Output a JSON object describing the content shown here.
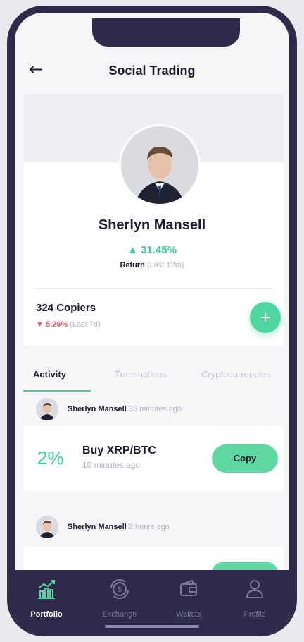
{
  "header": {
    "title": "Social Trading"
  },
  "profile": {
    "name": "Sherlyn Mansell",
    "return_value": "31.45%",
    "return_label": "Return",
    "return_period": "(Last 12m)",
    "copiers": "324 Copiers",
    "copiers_change": "5.26%",
    "copiers_period": "(Last 7d)"
  },
  "tabs": [
    {
      "label": "Activity",
      "active": true
    },
    {
      "label": "Transactions",
      "active": false
    },
    {
      "label": "Cryptocurrencies",
      "active": false
    }
  ],
  "feed": [
    {
      "author": "Sherlyn Mansell",
      "time": "35 minutes ago",
      "trade": {
        "percent": "2%",
        "title": "Buy XRP/BTC",
        "time": "10 minutes ago",
        "action": "Copy"
      }
    },
    {
      "author": "Sherlyn Mansell",
      "time": "2 hours ago"
    }
  ],
  "nav": [
    {
      "label": "Portfolio",
      "icon": "portfolio-icon",
      "active": true
    },
    {
      "label": "Exchange",
      "icon": "exchange-icon",
      "active": false
    },
    {
      "label": "Wallets",
      "icon": "wallet-icon",
      "active": false
    },
    {
      "label": "Profile",
      "icon": "profile-icon",
      "active": false
    }
  ],
  "colors": {
    "accent": "#3ecf94",
    "negative": "#e15b66",
    "nav_bg": "#2e2b4a"
  }
}
